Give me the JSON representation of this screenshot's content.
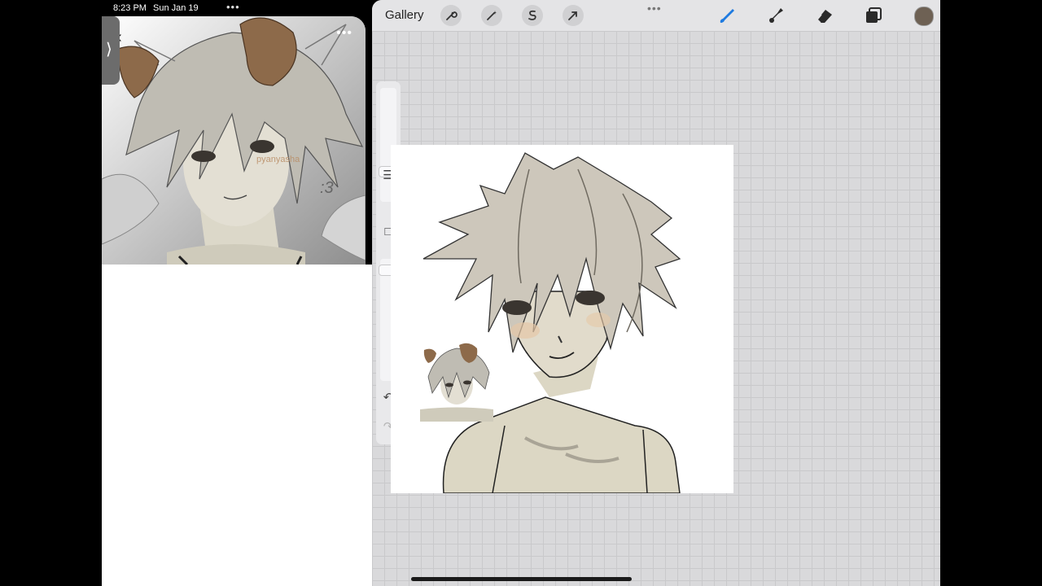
{
  "status_bar": {
    "time": "8:23 PM",
    "date": "Sun Jan 19",
    "multitask_dots": "•••"
  },
  "slideover": {
    "back_icon": "chevron-left-icon",
    "more_label": "•••",
    "tab_icon": "chevron-right-icon",
    "watermark": "pyanyasha",
    "face_text": ":3"
  },
  "toolbar": {
    "gallery_label": "Gallery",
    "top_dots": "•••",
    "tools": [
      "wrench-icon",
      "magic-wand-icon",
      "selection-icon",
      "transform-arrow-icon"
    ],
    "right_tools": [
      "brush-icon",
      "smudge-icon",
      "eraser-icon",
      "layers-icon"
    ],
    "active_color": "#6e6154",
    "brush_accent": "#1e7ae0"
  },
  "sidebar": {
    "brush_size_level": 0.25,
    "opacity_level": 0.05,
    "modify_icon": "square-icon",
    "undo_icon": "undo-icon",
    "redo_icon": "redo-icon"
  }
}
